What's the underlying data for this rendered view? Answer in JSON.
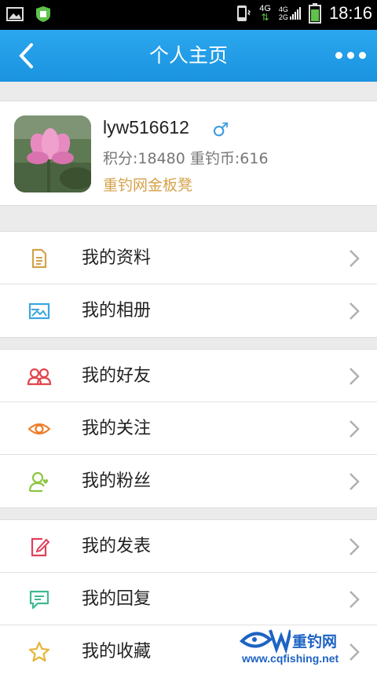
{
  "status_bar": {
    "time": "18:16",
    "net_4g": "4G",
    "net_4g_small": "4G",
    "net_2g": "2G"
  },
  "header": {
    "title": "个人主页"
  },
  "profile": {
    "username": "lyw516612",
    "gender_symbol": "♂",
    "stats": "积分:18480 重钓币:616",
    "rank": "重钓网金板凳"
  },
  "groups": [
    {
      "items": [
        {
          "label": "我的资料",
          "icon": "document-icon"
        },
        {
          "label": "我的相册",
          "icon": "image-icon"
        }
      ]
    },
    {
      "items": [
        {
          "label": "我的好友",
          "icon": "friends-icon"
        },
        {
          "label": "我的关注",
          "icon": "eye-icon"
        },
        {
          "label": "我的粉丝",
          "icon": "fans-icon"
        }
      ]
    },
    {
      "items": [
        {
          "label": "我的发表",
          "icon": "edit-icon"
        },
        {
          "label": "我的回复",
          "icon": "reply-icon"
        },
        {
          "label": "我的收藏",
          "icon": "star-icon"
        }
      ]
    }
  ],
  "watermark": {
    "name": "重钓网",
    "url": "www.cqfishing.net"
  },
  "colors": {
    "header": "#1b93df",
    "gold": "#d4a24a",
    "gender": "#3c9be0"
  }
}
